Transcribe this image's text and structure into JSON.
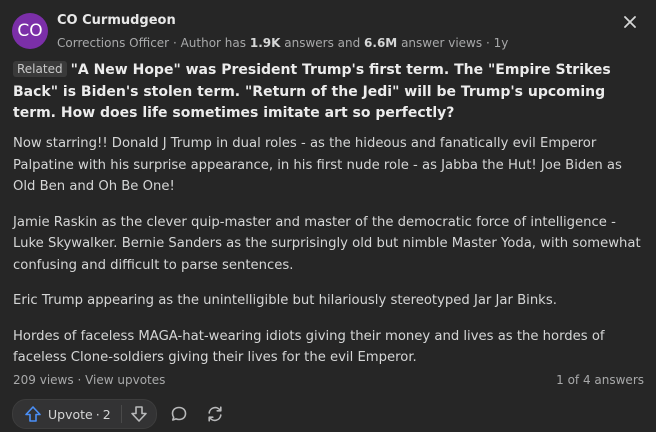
{
  "author": {
    "avatar_text": "CO",
    "avatar_color": "#7b2fa8",
    "name": "CO Curmudgeon",
    "credential": "Corrections Officer",
    "has_prefix": "Author has",
    "answers_count": "1.9K",
    "answers_label": "answers and",
    "views_count": "6.6M",
    "views_label": "answer views",
    "age": "1y"
  },
  "question": {
    "badge": "Related",
    "text": "\"A New Hope\" was President Trump's first term. The \"Empire Strikes Back\" is Biden's stolen term. \"Return of the Jedi\" will be Trump's upcoming term. How does life sometimes imitate art so perfectly?"
  },
  "answer_paragraphs": [
    "Now starring!! Donald J Trump in dual roles - as the hideous and fanatically evil Emperor Palpatine with his surprise appearance, in his first nude role - as Jabba the Hut! Joe Biden as Old Ben and Oh Be One!",
    "Jamie Raskin as the clever quip-master and master of the democratic force of intelligence - Luke Skywalker. Bernie Sanders as the surprisingly old but nimble Master Yoda, with somewhat confusing and difficult to parse sentences.",
    "Eric Trump appearing as the unintelligible but hilariously stereotyped Jar Jar Binks.",
    "Hordes of faceless MAGA-hat-wearing idiots giving their money and lives as the hordes of faceless Clone-soldiers giving their lives for the evil Emperor."
  ],
  "stats": {
    "views": "209 views",
    "separator": "·",
    "view_upvotes": "View upvotes",
    "answer_position": "1 of 4 answers"
  },
  "actions": {
    "upvote_label": "Upvote",
    "upvote_sep": "·",
    "upvote_count": "2",
    "upvote_icon": "arrow-up-icon",
    "downvote_icon": "arrow-down-icon",
    "comment_icon": "comment-bubble-icon",
    "share_icon": "share-refresh-icon",
    "accent_color": "#4a8ff7"
  }
}
